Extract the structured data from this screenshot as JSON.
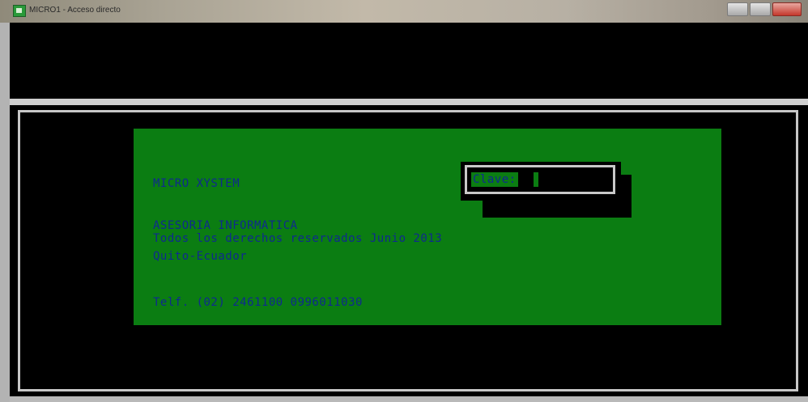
{
  "window": {
    "title": "MICRO1 - Acceso directo",
    "controls": [
      "minimize",
      "maximize",
      "close"
    ]
  },
  "icons": {
    "app": "console-app-icon"
  },
  "dialog": {
    "system_name": "MICRO XYSTEM",
    "company": "ASESORIA INFORMATICA",
    "rights": "Todos los derechos reservados Junio 2013",
    "location": "Quito-Ecuador",
    "phone": "Telf. (02) 2461100  0996011030",
    "password_label": "Clave:",
    "password_value": ""
  },
  "colors": {
    "console_bg": "#000000",
    "panel_green": "#0b7d12",
    "text_blue": "#0f2a8e",
    "frame_gray": "#c7c7c7"
  }
}
